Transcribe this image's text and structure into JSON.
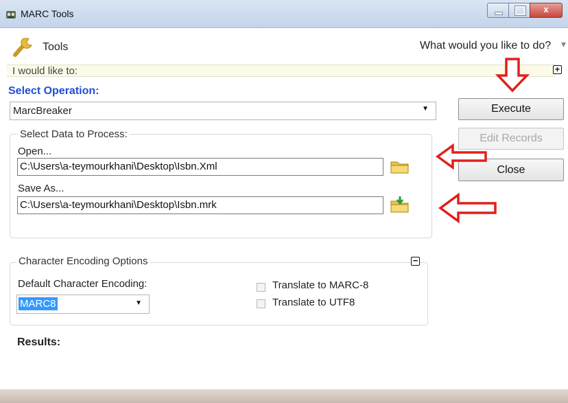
{
  "window": {
    "title": "MARC Tools",
    "min_glyph": "",
    "max_glyph": "",
    "close_glyph": "x"
  },
  "header": {
    "title": "Tools",
    "prompt": "What would you like to do?",
    "prompt_caret": "▾"
  },
  "task_bar": {
    "label": "I would like to:",
    "expand_glyph": "+"
  },
  "operation": {
    "label": "Select Operation:",
    "value": "MarcBreaker",
    "arrow": "▼"
  },
  "buttons": {
    "execute": "Execute",
    "edit_records": "Edit Records",
    "close": "Close"
  },
  "data_group": {
    "title": "Select Data to Process:",
    "open_label": "Open...",
    "open_path": "C:\\Users\\a-teymourkhani\\Desktop\\Isbn.Xml",
    "save_label": "Save As...",
    "save_path": "C:\\Users\\a-teymourkhani\\Desktop\\Isbn.mrk"
  },
  "encoding_group": {
    "title": "Character Encoding Options",
    "collapse_glyph": "−",
    "default_label": "Default Character Encoding:",
    "default_value": "MARC8",
    "arrow": "▼",
    "translate_marc8": "Translate to MARC-8",
    "translate_utf8": "Translate to UTF8",
    "translate_marc8_checked": false,
    "translate_utf8_checked": false
  },
  "results": {
    "label": "Results:"
  },
  "annotation_color": "#e0201b"
}
